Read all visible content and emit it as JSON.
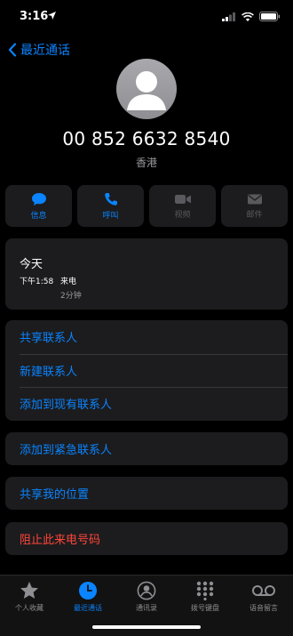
{
  "status": {
    "time": "3:16"
  },
  "nav": {
    "back_label": "最近通话"
  },
  "contact": {
    "number": "00 852 6632 8540",
    "region": "香港"
  },
  "actions": [
    {
      "label": "信息",
      "icon": "message-bubble-icon",
      "enabled": true
    },
    {
      "label": "呼叫",
      "icon": "phone-icon",
      "enabled": true
    },
    {
      "label": "视频",
      "icon": "video-camera-icon",
      "enabled": false
    },
    {
      "label": "邮件",
      "icon": "mail-icon",
      "enabled": false
    }
  ],
  "history": {
    "date": "今天",
    "time": "下午1:58",
    "type": "来电",
    "duration": "2分钟"
  },
  "menu": {
    "share_contact": "共享联系人",
    "new_contact": "新建联系人",
    "add_existing": "添加到现有联系人",
    "add_emergency": "添加到紧急联系人",
    "share_location": "共享我的位置",
    "block": "阻止此来电号码"
  },
  "tabs": [
    {
      "label": "个人收藏",
      "icon": "star-icon",
      "active": false
    },
    {
      "label": "最近通话",
      "icon": "clock-icon",
      "active": true
    },
    {
      "label": "通讯录",
      "icon": "contact-circle-icon",
      "active": false
    },
    {
      "label": "拨号键盘",
      "icon": "keypad-icon",
      "active": false
    },
    {
      "label": "语音留言",
      "icon": "voicemail-icon",
      "active": false
    }
  ],
  "colors": {
    "accent": "#0a84ff",
    "danger": "#ff453a",
    "card": "#1c1c1e"
  }
}
